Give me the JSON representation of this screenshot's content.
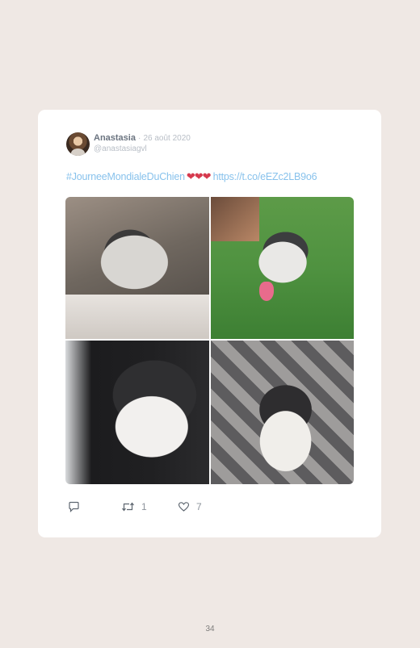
{
  "tweet": {
    "author_name": "Anastasia",
    "separator": "·",
    "date": "26 août 2020",
    "handle": "@anastasiagvl",
    "hashtag": "#JourneeMondialeDuChien",
    "hearts": "❤❤❤",
    "link": "https://t.co/eEZc2LB9o6",
    "photos": [
      {
        "description_icon": "husky-lying-on-tiles-photo"
      },
      {
        "description_icon": "husky-on-grass-photo"
      },
      {
        "description_icon": "husky-profile-photo"
      },
      {
        "description_icon": "husky-on-couch-photo"
      }
    ],
    "actions": {
      "reply_icon": "reply-icon",
      "retweet_icon": "retweet-icon",
      "retweet_count": "1",
      "like_icon": "heart-icon",
      "like_count": "7"
    }
  },
  "page_number": "34",
  "colors": {
    "background": "#efe8e4",
    "card": "#ffffff",
    "link": "#88c2ec",
    "hearts": "#d63a4e"
  }
}
